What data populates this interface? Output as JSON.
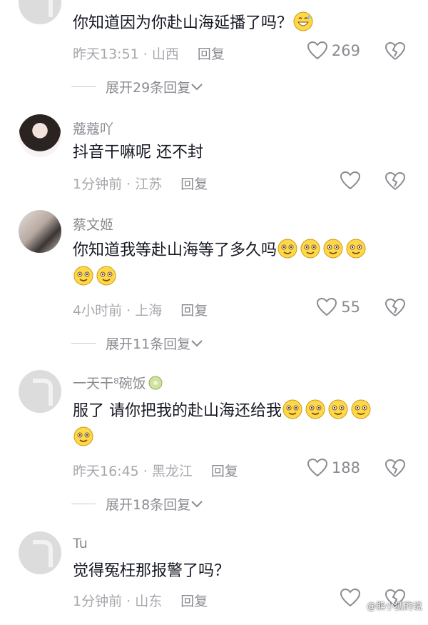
{
  "comments": [
    {
      "text": "你知道因为你赴山海延播了吗？",
      "time": "昨天13:51",
      "location": "山西",
      "reply_label": "回复",
      "likes": "269",
      "expand_label": "展开29条回复"
    },
    {
      "name": "蔻蔻吖",
      "text": "抖音干嘛呢  还不封",
      "time": "1分钟前",
      "location": "江苏",
      "reply_label": "回复"
    },
    {
      "name": "蔡文姬",
      "text": "你知道我等赴山海等了多久吗",
      "time": "4小时前",
      "location": "上海",
      "reply_label": "回复",
      "likes": "55",
      "expand_label": "展开11条回复"
    },
    {
      "name": "一天干⁸碗饭",
      "text": "服了 请你把我的赴山海还给我",
      "time": "昨天16:45",
      "location": "黑龙江",
      "reply_label": "回复",
      "likes": "188",
      "expand_label": "展开18条回复"
    },
    {
      "name": "Tu",
      "text": "觉得冤枉那报警了吗？",
      "time": "1分钟前",
      "location": "山东",
      "reply_label": "回复"
    }
  ],
  "watermark": "@熊小狐的说",
  "colors": {
    "text": "#161823",
    "secondary": "#8a8b91",
    "emoji": "#ffd84a"
  }
}
